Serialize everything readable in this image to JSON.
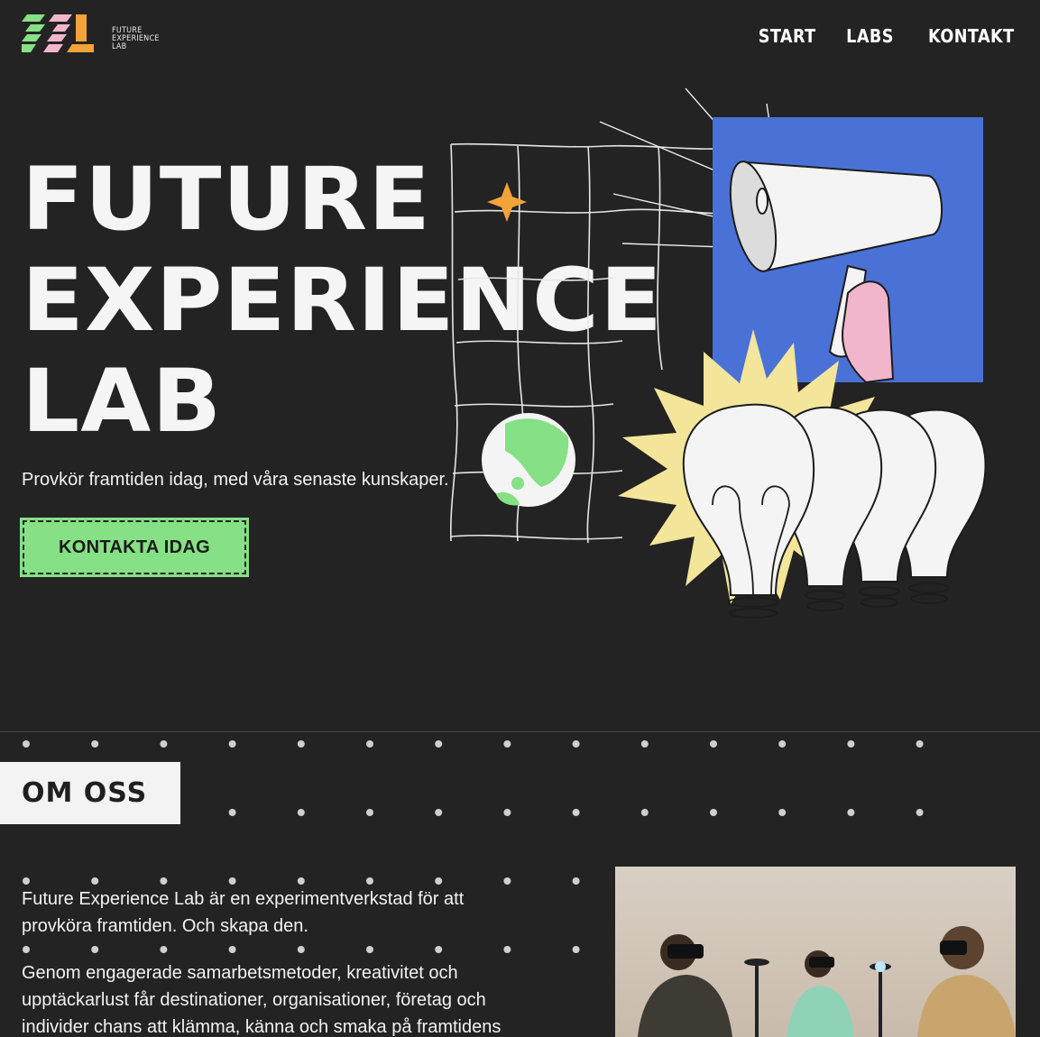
{
  "header": {
    "logo_lines": [
      "FUTURE",
      "EXPERIENCE",
      "LAB"
    ],
    "nav": [
      "START",
      "LABS",
      "KONTAKT"
    ]
  },
  "hero": {
    "title_lines": [
      "FUTURE",
      "EXPERIENCE",
      "LAB"
    ],
    "subtitle": "Provkör framtiden idag, med våra senaste kunskaper.",
    "cta_label": "KONTAKTA IDAG"
  },
  "about": {
    "heading": "OM OSS",
    "paragraphs": [
      "Future Experience Lab är en experimentverkstad för att provköra framtiden. Och skapa den.",
      "Genom engagerade samarbetsmetoder, kreativitet och upptäckarlust får destinationer, organisationer, företag och individer chans att klämma, känna och smaka på framtidens"
    ]
  },
  "colors": {
    "background": "#232323",
    "accent_green": "#86e085",
    "accent_blue": "#4a72d6",
    "accent_yellow": "#f3e59a",
    "accent_orange": "#f2a33a",
    "accent_pink": "#f2b6cc"
  },
  "icons": [
    "megaphone-illustration",
    "lightbulb-illustration",
    "globe-illustration",
    "sparkle-icon",
    "grid-illustration"
  ]
}
